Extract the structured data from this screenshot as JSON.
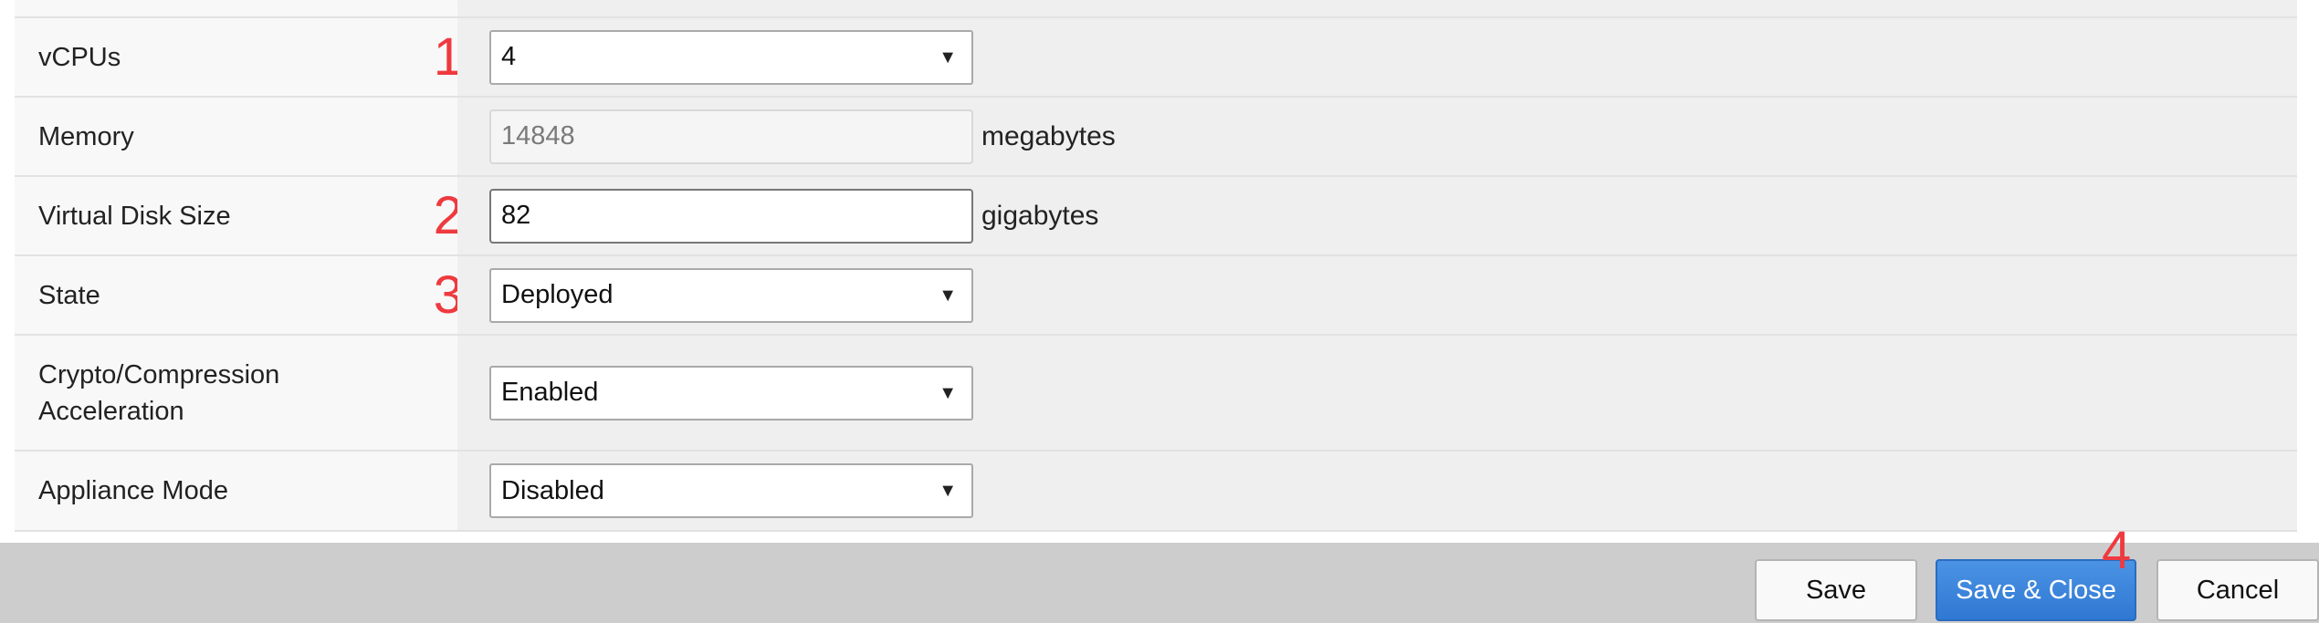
{
  "form": {
    "rows": [
      {
        "label": "vCPUs",
        "step": "1",
        "control": "select",
        "value": "4"
      },
      {
        "label": "Memory",
        "control": "input-disabled",
        "value": "14848",
        "unit": "megabytes"
      },
      {
        "label": "Virtual Disk Size",
        "step": "2",
        "control": "input",
        "value": "82",
        "unit": "gigabytes"
      },
      {
        "label": "State",
        "step": "3",
        "control": "select",
        "value": "Deployed"
      },
      {
        "label_line1": "Crypto/Compression",
        "label_line2": "Acceleration",
        "control": "select",
        "value": "Enabled"
      },
      {
        "label": "Appliance Mode",
        "control": "select",
        "value": "Disabled"
      }
    ]
  },
  "footer": {
    "save_label": "Save",
    "save_close_label": "Save & Close",
    "cancel_label": "Cancel",
    "step": "4"
  },
  "icons": {
    "dropdown_arrow": "▼"
  },
  "colors": {
    "annotation_red": "#ee3a3f",
    "primary_button": "#3a84dc",
    "footer_bg": "#cdcdcd"
  }
}
